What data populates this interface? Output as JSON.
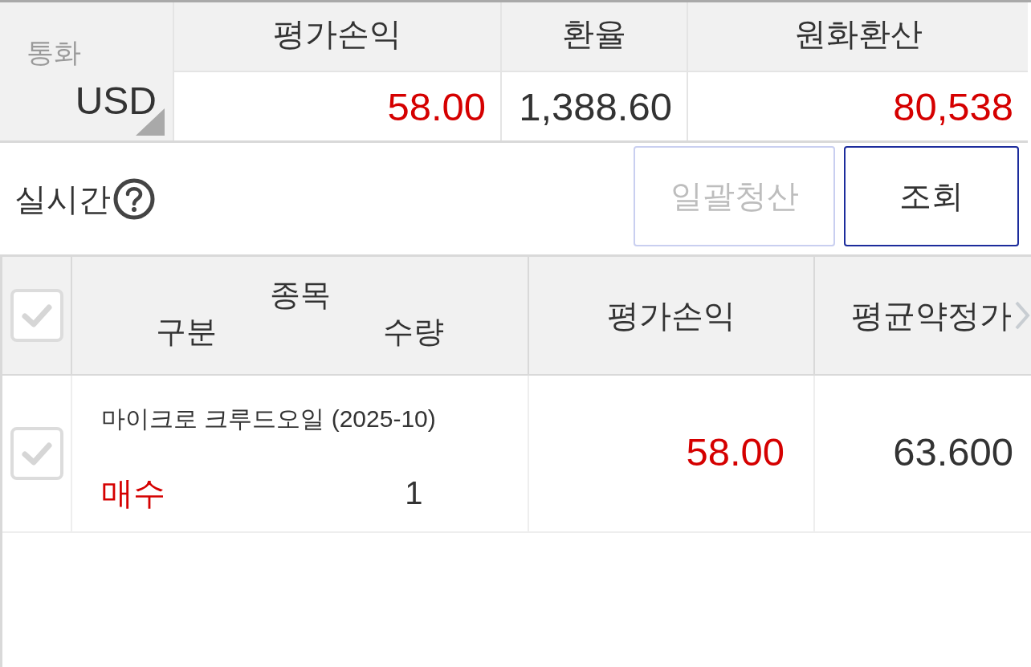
{
  "summary": {
    "currency": {
      "label": "통화",
      "value": "USD"
    },
    "columns": [
      {
        "header": "평가손익",
        "value": "58.00",
        "color": "#d50000"
      },
      {
        "header": "환율",
        "value": "1,388.60",
        "color": "#333333"
      },
      {
        "header": "원화환산",
        "value": "80,538",
        "color": "#d50000"
      }
    ]
  },
  "realtime": {
    "label": "실시간"
  },
  "buttons": [
    {
      "label": "일괄청산",
      "disabled": true
    },
    {
      "label": "조회",
      "disabled": false
    }
  ],
  "positions": {
    "select_all": {
      "checked": false
    },
    "header": {
      "instrument": "종목",
      "side": "구분",
      "quantity": "수량",
      "columns": [
        "평가손익",
        "평균약정가"
      ]
    },
    "rows": [
      {
        "checked": false,
        "instrument": "마이크로 크루드오일 (2025-10)",
        "side": {
          "text": "매수",
          "color": "#d50000"
        },
        "quantity": "1",
        "pnl": {
          "text": "58.00",
          "color": "#d50000"
        },
        "avg_price": "63.600"
      }
    ]
  }
}
